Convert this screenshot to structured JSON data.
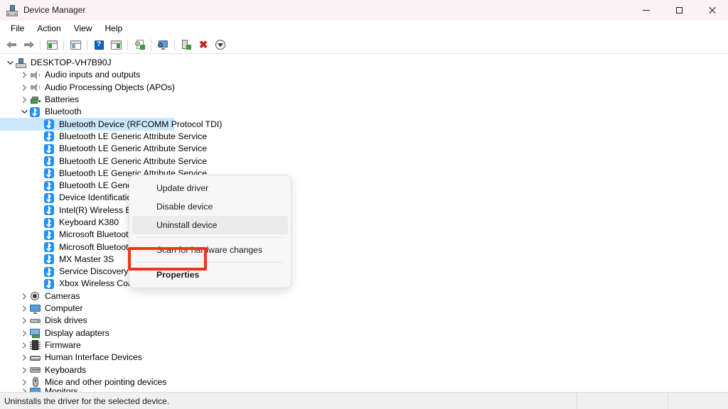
{
  "window": {
    "title": "Device Manager",
    "icon": "device-manager-icon",
    "controls": {
      "minimize": "minimize",
      "maximize": "maximize",
      "close": "close"
    }
  },
  "menubar": {
    "items": [
      {
        "label": "File"
      },
      {
        "label": "Action"
      },
      {
        "label": "View"
      },
      {
        "label": "Help"
      }
    ]
  },
  "toolbar": {
    "buttons": [
      {
        "name": "back-arrow-icon"
      },
      {
        "name": "forward-arrow-icon"
      },
      {
        "name": "show-hide-console-tree-icon"
      },
      {
        "name": "properties-window-icon"
      },
      {
        "name": "help-icon"
      },
      {
        "name": "show-hide-action-pane-icon"
      },
      {
        "name": "update-driver-icon"
      },
      {
        "name": "scan-for-hardware-changes-icon"
      },
      {
        "name": "uninstall-device-icon"
      },
      {
        "name": "disable-device-icon"
      },
      {
        "name": "enable-device-icon"
      }
    ]
  },
  "tree": {
    "root": {
      "label": "DESKTOP-VH7B90J",
      "icon": "computer-icon",
      "expanded": true
    },
    "nodes": [
      {
        "label": "Audio inputs and outputs",
        "icon": "speaker-icon",
        "level": 1,
        "expanded": false
      },
      {
        "label": "Audio Processing Objects (APOs)",
        "icon": "speaker-icon",
        "level": 1,
        "expanded": false
      },
      {
        "label": "Batteries",
        "icon": "battery-icon",
        "level": 1,
        "expanded": false
      },
      {
        "label": "Bluetooth",
        "icon": "bluetooth-icon",
        "level": 1,
        "expanded": true
      },
      {
        "label": "Bluetooth Device (RFCOMM Protocol TDI)",
        "icon": "bluetooth-icon",
        "level": 2,
        "selected": true
      },
      {
        "label": "Bluetooth LE Generic Attribute Service",
        "icon": "bluetooth-icon",
        "level": 2
      },
      {
        "label": "Bluetooth LE Generic Attribute Service",
        "icon": "bluetooth-icon",
        "level": 2
      },
      {
        "label": "Bluetooth LE Generic Attribute Service",
        "icon": "bluetooth-icon",
        "level": 2
      },
      {
        "label": "Bluetooth LE Generic Attribute Service",
        "icon": "bluetooth-icon",
        "level": 2
      },
      {
        "label": "Bluetooth LE Generic Attribute Service",
        "icon": "bluetooth-icon",
        "level": 2
      },
      {
        "label": "Device Identification Service",
        "icon": "bluetooth-icon",
        "level": 2
      },
      {
        "label": "Intel(R) Wireless Bluetooth(R)",
        "icon": "bluetooth-icon",
        "level": 2
      },
      {
        "label": "Keyboard K380",
        "icon": "bluetooth-icon",
        "level": 2
      },
      {
        "label": "Microsoft Bluetooth Enumerator",
        "icon": "bluetooth-icon",
        "level": 2
      },
      {
        "label": "Microsoft Bluetooth LE Enumerator",
        "icon": "bluetooth-icon",
        "level": 2
      },
      {
        "label": "MX Master 3S",
        "icon": "bluetooth-icon",
        "level": 2
      },
      {
        "label": "Service Discovery Service",
        "icon": "bluetooth-icon",
        "level": 2
      },
      {
        "label": "Xbox Wireless Controller",
        "icon": "bluetooth-icon",
        "level": 2
      },
      {
        "label": "Cameras",
        "icon": "camera-icon",
        "level": 1,
        "expanded": false
      },
      {
        "label": "Computer",
        "icon": "monitor-icon",
        "level": 1,
        "expanded": false
      },
      {
        "label": "Disk drives",
        "icon": "disk-icon",
        "level": 1,
        "expanded": false
      },
      {
        "label": "Display adapters",
        "icon": "display-adapter-icon",
        "level": 1,
        "expanded": false
      },
      {
        "label": "Firmware",
        "icon": "firmware-icon",
        "level": 1,
        "expanded": false
      },
      {
        "label": "Human Interface Devices",
        "icon": "hid-icon",
        "level": 1,
        "expanded": false
      },
      {
        "label": "Keyboards",
        "icon": "keyboard-icon",
        "level": 1,
        "expanded": false
      },
      {
        "label": "Mice and other pointing devices",
        "icon": "mouse-icon",
        "level": 1,
        "expanded": false
      },
      {
        "label": "Monitors",
        "icon": "monitor-icon",
        "level": 1,
        "expanded": false,
        "clipped": true
      }
    ]
  },
  "context_menu": {
    "items": [
      {
        "label": "Update driver",
        "type": "item"
      },
      {
        "label": "Disable device",
        "type": "item"
      },
      {
        "label": "Uninstall device",
        "type": "item",
        "hovered": true
      },
      {
        "type": "separator"
      },
      {
        "label": "Scan for hardware changes",
        "type": "item"
      },
      {
        "type": "separator"
      },
      {
        "label": "Properties",
        "type": "item",
        "bold": true,
        "highlighted": true
      }
    ]
  },
  "highlight": {
    "color": "#f4331c",
    "target": "Properties"
  },
  "statusbar": {
    "message": "Uninstalls the driver for the selected device.",
    "segment2": "",
    "segment3": ""
  }
}
